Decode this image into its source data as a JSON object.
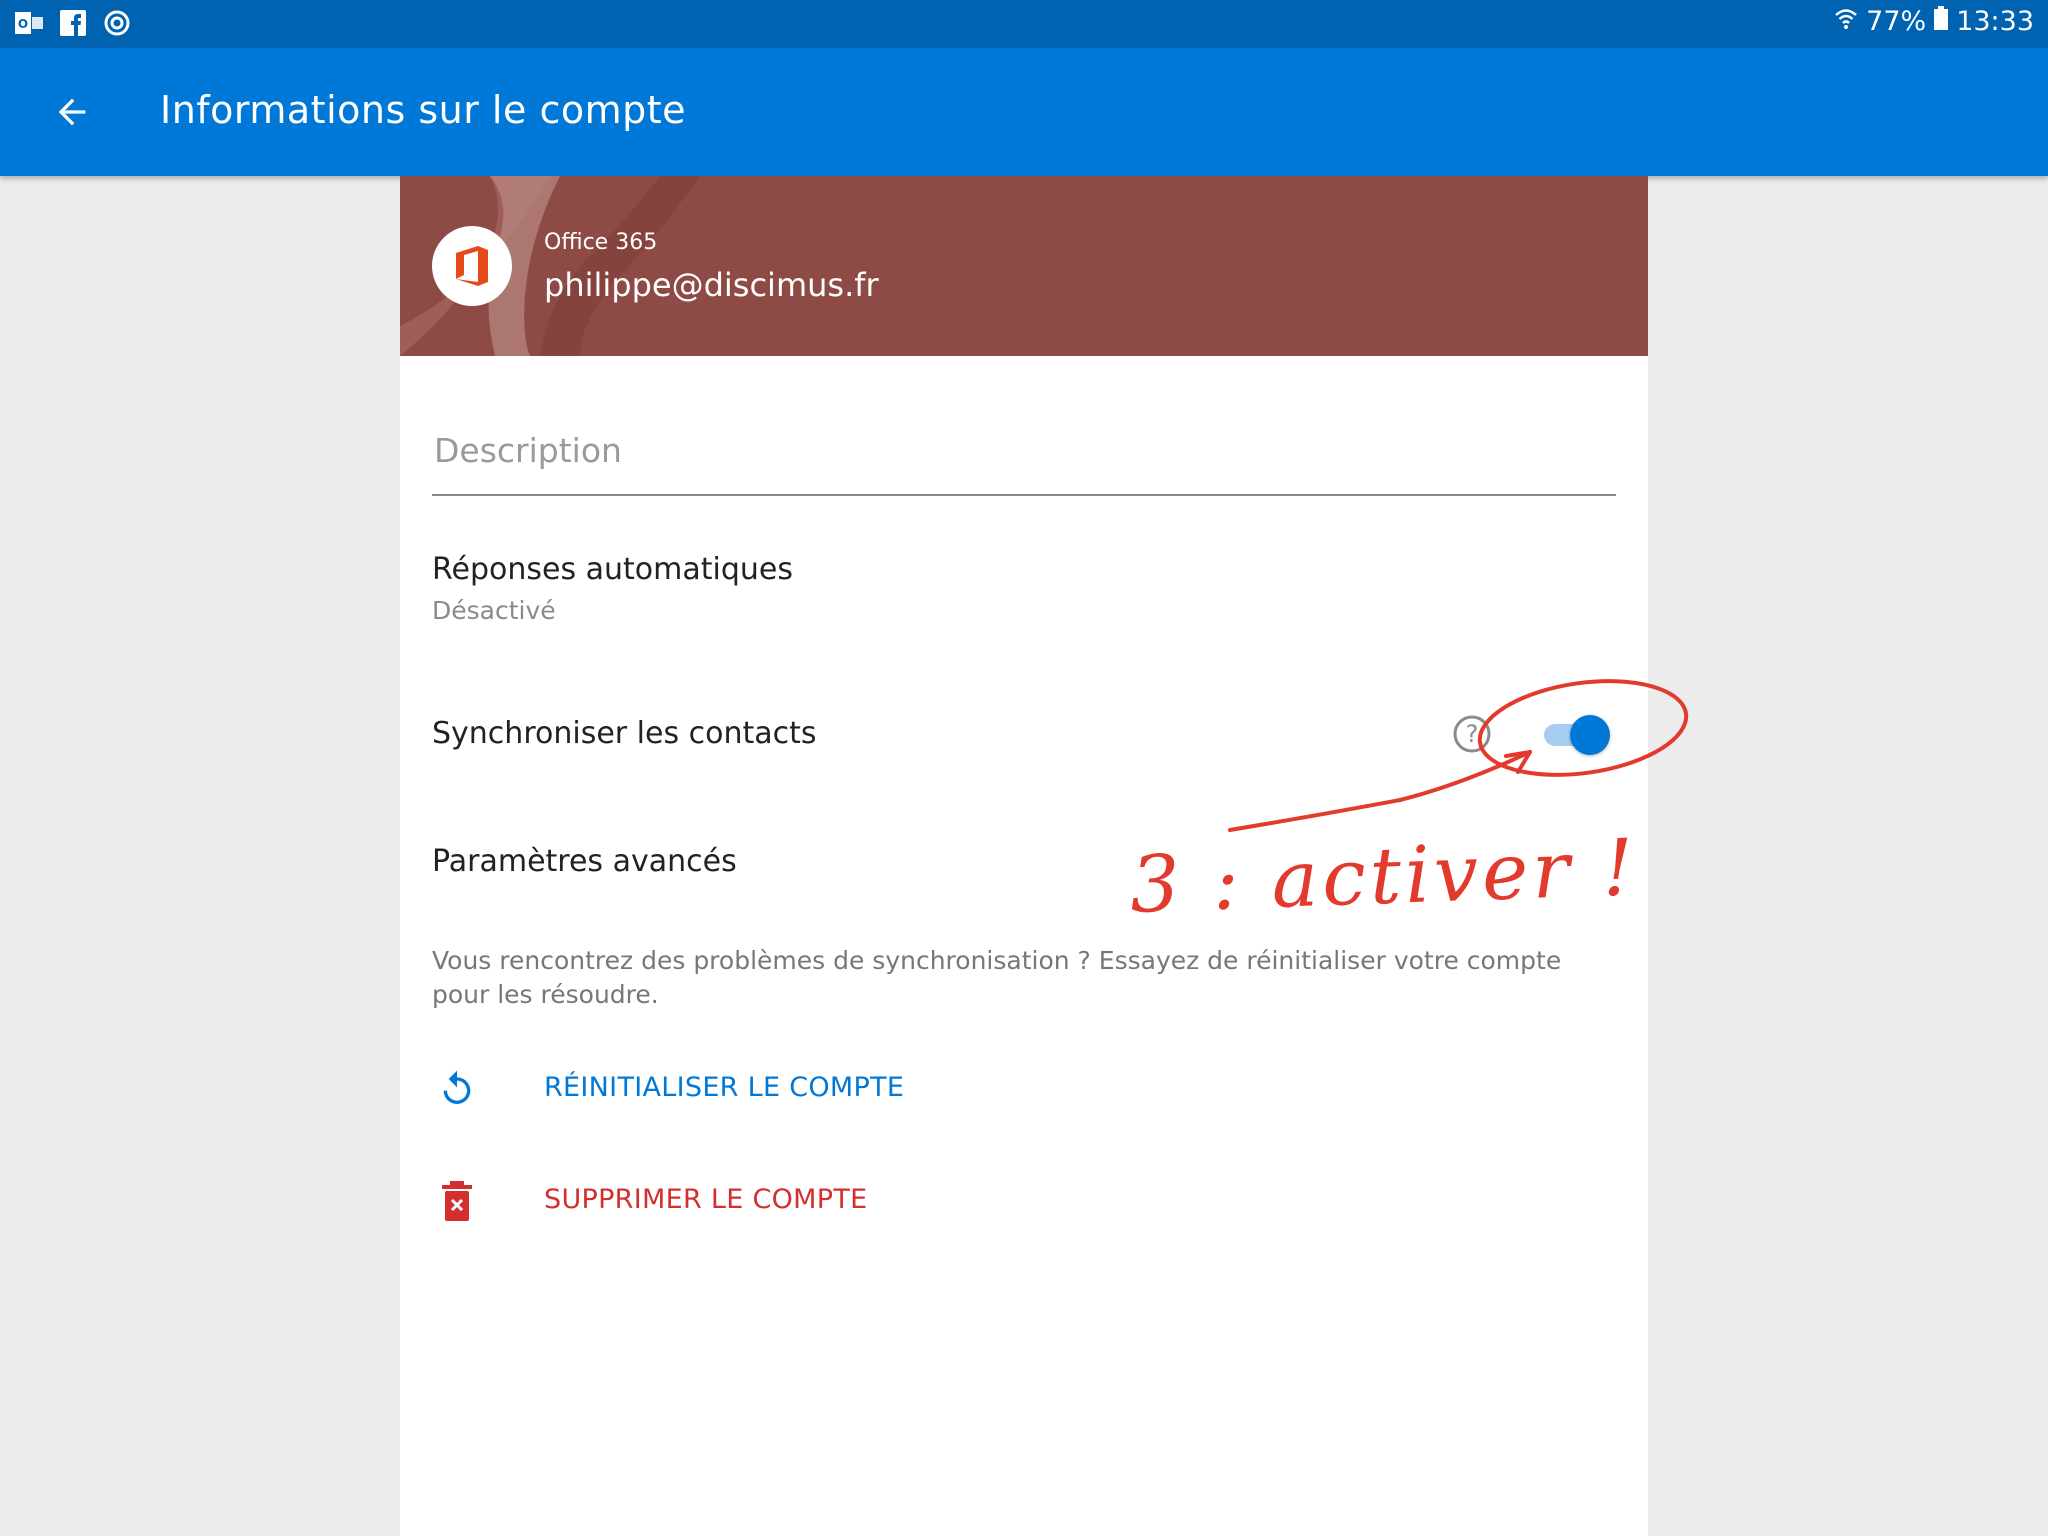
{
  "status_bar": {
    "icons": [
      "outlook-icon",
      "facebook-icon",
      "sync-app-icon"
    ],
    "battery": "77%",
    "time": "13:33"
  },
  "app_bar": {
    "title": "Informations sur le compte",
    "back_icon": "arrow-back-icon"
  },
  "account": {
    "provider": "Office 365",
    "email": "philippe@discimus.fr",
    "hero_color": "#8e4a45"
  },
  "form": {
    "description_placeholder": "Description",
    "description_value": ""
  },
  "settings": {
    "auto_reply_title": "Réponses automatiques",
    "auto_reply_status": "Désactivé",
    "sync_contacts_title": "Synchroniser les contacts",
    "sync_contacts_on": true,
    "advanced_title": "Paramètres avancés"
  },
  "hint_text": "Vous rencontrez des problèmes de synchronisation ? Essayez de réinitialiser votre compte pour les résoudre.",
  "actions": {
    "reset_label": "RÉINITIALISER LE COMPTE",
    "reset_color": "#0078d7",
    "delete_label": "SUPPRIMER LE COMPTE",
    "delete_color": "#d32f2f"
  },
  "annotation": {
    "text": "3 : activer !",
    "color": "#e33a2e"
  },
  "colors": {
    "status_bar": "#0063b1",
    "app_bar": "#0078d7",
    "accent": "#0078d7"
  }
}
